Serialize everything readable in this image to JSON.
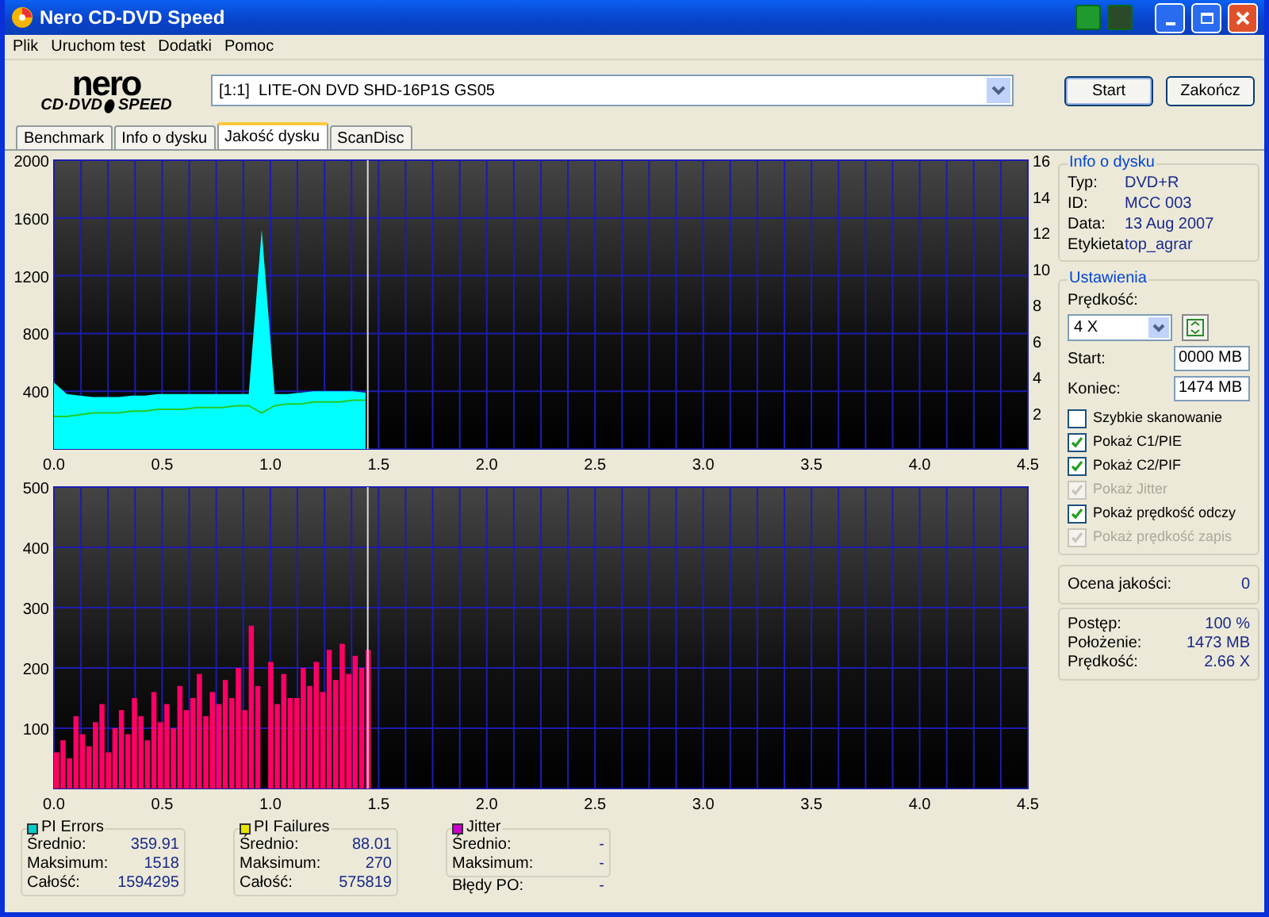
{
  "window": {
    "title": "Nero CD-DVD Speed"
  },
  "menu": [
    "Plik",
    "Uruchom test",
    "Dodatki",
    "Pomoc"
  ],
  "logo": {
    "top": "nero",
    "left": "CD·DVD",
    "right": "SPEED"
  },
  "drive": {
    "value": "[1:1]  LITE-ON DVD SHD-16P1S GS05"
  },
  "buttons": [
    "Start",
    "Zakończ"
  ],
  "tabs": [
    {
      "label": "Benchmark",
      "selected": false
    },
    {
      "label": "Info o dysku",
      "selected": false
    },
    {
      "label": "Jakość dysku",
      "selected": true
    },
    {
      "label": "ScanDisc",
      "selected": false
    }
  ],
  "chart_top": {
    "chart_data": {
      "type": "area",
      "xlim": [
        0,
        4.5
      ],
      "ylim": [
        0,
        2000
      ],
      "y2lim": [
        0,
        16
      ],
      "y2ticks": [
        2,
        4,
        6,
        8,
        10,
        12,
        14,
        16
      ],
      "grid": true,
      "ref_lines": [
        {
          "axis": "x",
          "value": 1.45,
          "color": "#dddddd"
        }
      ],
      "xticks": [
        {
          "value": 0,
          "label": "0.0"
        },
        {
          "value": 0.5,
          "label": "0.5"
        },
        {
          "value": 1,
          "label": "1.0"
        },
        {
          "value": 1.5,
          "label": "1.5"
        },
        {
          "value": 2,
          "label": "2.0"
        },
        {
          "value": 2.5,
          "label": "2.5"
        },
        {
          "value": 3,
          "label": "3.0"
        },
        {
          "value": 3.5,
          "label": "3.5"
        },
        {
          "value": 4,
          "label": "4.0"
        },
        {
          "value": 4.5,
          "label": "4.5"
        }
      ],
      "yticks": [
        400,
        800,
        1200,
        1600,
        2000
      ],
      "x": [
        0,
        0.06,
        0.12,
        0.18,
        0.24,
        0.3,
        0.36,
        0.42,
        0.48,
        0.54,
        0.6,
        0.66,
        0.72,
        0.78,
        0.84,
        0.9,
        0.96,
        1.02,
        1.08,
        1.14,
        1.2,
        1.26,
        1.32,
        1.38,
        1.44
      ],
      "series": [
        {
          "color": "#00ffff",
          "values": [
            460,
            380,
            370,
            360,
            360,
            360,
            370,
            370,
            380,
            380,
            380,
            380,
            380,
            380,
            380,
            380,
            1518,
            380,
            380,
            390,
            400,
            400,
            400,
            400,
            390
          ]
        },
        {
          "type": "line",
          "color": "#22cc22",
          "axis": "y2",
          "values": [
            1.8,
            1.8,
            1.9,
            2,
            2,
            2,
            2.1,
            2.1,
            2.2,
            2.2,
            2.2,
            2.3,
            2.3,
            2.3,
            2.4,
            2.4,
            2,
            2.4,
            2.5,
            2.5,
            2.6,
            2.6,
            2.6,
            2.7,
            2.7
          ]
        }
      ]
    }
  },
  "chart_bottom": {
    "chart_data": {
      "type": "bar",
      "xlim": [
        0,
        4.5
      ],
      "ylim": [
        0,
        500
      ],
      "grid": true,
      "ref_lines": [
        {
          "axis": "x",
          "value": 1.45,
          "color": "#dddddd"
        }
      ],
      "xticks": [
        {
          "value": 0,
          "label": "0.0"
        },
        {
          "value": 0.5,
          "label": "0.5"
        },
        {
          "value": 1,
          "label": "1.0"
        },
        {
          "value": 1.5,
          "label": "1.5"
        },
        {
          "value": 2,
          "label": "2.0"
        },
        {
          "value": 2.5,
          "label": "2.5"
        },
        {
          "value": 3,
          "label": "3.0"
        },
        {
          "value": 3.5,
          "label": "3.5"
        },
        {
          "value": 4,
          "label": "4.0"
        },
        {
          "value": 4.5,
          "label": "4.5"
        }
      ],
      "yticks": [
        100,
        200,
        300,
        400,
        500
      ],
      "x": [
        0,
        0.03,
        0.06,
        0.09,
        0.12,
        0.15,
        0.18,
        0.21,
        0.24,
        0.27,
        0.3,
        0.33,
        0.36,
        0.39,
        0.42,
        0.45,
        0.48,
        0.51,
        0.54,
        0.57,
        0.6,
        0.63,
        0.66,
        0.69,
        0.72,
        0.75,
        0.78,
        0.81,
        0.84,
        0.87,
        0.9,
        0.93,
        0.96,
        0.99,
        1.02,
        1.05,
        1.08,
        1.11,
        1.14,
        1.17,
        1.2,
        1.23,
        1.26,
        1.29,
        1.32,
        1.35,
        1.38,
        1.41,
        1.44
      ],
      "series": [
        {
          "color": "#ff0066",
          "values": [
            60,
            80,
            50,
            120,
            90,
            70,
            110,
            140,
            60,
            100,
            130,
            90,
            150,
            120,
            80,
            160,
            110,
            140,
            100,
            170,
            130,
            150,
            190,
            120,
            160,
            140,
            180,
            150,
            200,
            130,
            270,
            170,
            0,
            210,
            140,
            190,
            150,
            150,
            200,
            170,
            210,
            160,
            230,
            180,
            240,
            190,
            220,
            200,
            230
          ]
        }
      ]
    }
  },
  "stats": [
    {
      "title": "PI Errors",
      "color": "#00cccc",
      "rows": [
        {
          "label": "Średnio:",
          "value": "359.91"
        },
        {
          "label": "Maksimum:",
          "value": "1518"
        },
        {
          "label": "Całość:",
          "value": "1594295"
        }
      ]
    },
    {
      "title": "PI Failures",
      "color": "#e6e600",
      "rows": [
        {
          "label": "Średnio:",
          "value": "88.01"
        },
        {
          "label": "Maksimum:",
          "value": "270"
        },
        {
          "label": "Całość:",
          "value": "575819"
        }
      ]
    },
    {
      "title": "Jitter",
      "color": "#cc00cc",
      "rows": [
        {
          "label": "Średnio:",
          "value": "-"
        },
        {
          "label": "Maksimum:",
          "value": "-"
        }
      ],
      "extra": {
        "label": "Błędy PO:",
        "value": "-"
      }
    }
  ],
  "disc_info": {
    "title": "Info o dysku",
    "rows": [
      {
        "label": "Typ:",
        "value": "DVD+R"
      },
      {
        "label": "ID:",
        "value": "MCC 003"
      },
      {
        "label": "Data:",
        "value": "13 Aug 2007"
      },
      {
        "label": "Etykieta",
        "value": "top_agrar"
      }
    ]
  },
  "settings": {
    "title": "Ustawienia",
    "speed_label": "Prędkość:",
    "speed": "4 X",
    "start_label": "Start:",
    "start": "0000 MB",
    "end_label": "Koniec:",
    "end": "1474 MB",
    "options": [
      {
        "label": "Szybkie skanowanie",
        "checked": false,
        "disabled": false
      },
      {
        "label": "Pokaż C1/PIE",
        "checked": true,
        "disabled": false
      },
      {
        "label": "Pokaż C2/PIF",
        "checked": true,
        "disabled": false
      },
      {
        "label": "Pokaż Jitter",
        "checked": true,
        "disabled": true
      },
      {
        "label": "Pokaż prędkość odczy",
        "checked": true,
        "disabled": false
      },
      {
        "label": "Pokaż prędkość zapis",
        "checked": true,
        "disabled": true
      }
    ]
  },
  "quality": {
    "label": "Ocena jakości:",
    "value": "0"
  },
  "progress": [
    {
      "label": "Postęp:",
      "value": "100 %"
    },
    {
      "label": "Położenie:",
      "value": "1473 MB"
    },
    {
      "label": "Prędkość:",
      "value": "2.66 X"
    }
  ]
}
